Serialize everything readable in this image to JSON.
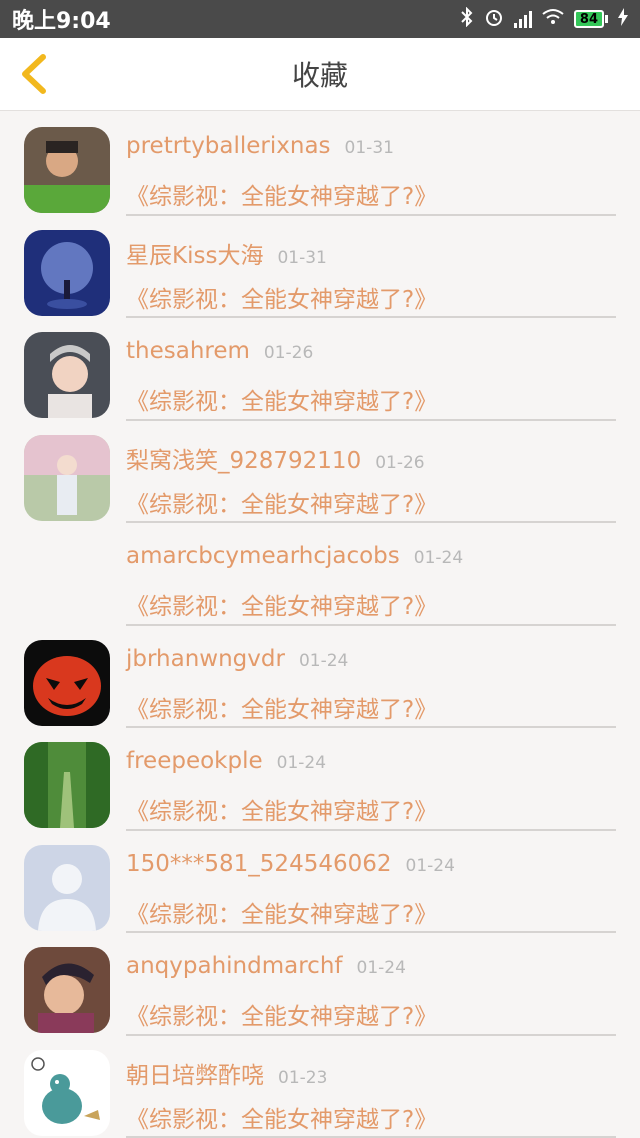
{
  "status": {
    "time": "晚上9:04",
    "battery": "84"
  },
  "header": {
    "title": "收藏"
  },
  "items": [
    {
      "name": "pretrtyballerixnas",
      "date": "01-31",
      "subtitle": "《综影视：全能女神穿越了?》"
    },
    {
      "name": "星辰Kiss大海",
      "date": "01-31",
      "subtitle": "《综影视：全能女神穿越了?》"
    },
    {
      "name": "thesahrem",
      "date": "01-26",
      "subtitle": "《综影视：全能女神穿越了?》"
    },
    {
      "name": "梨窝浅笑_928792110",
      "date": "01-26",
      "subtitle": "《综影视：全能女神穿越了?》"
    },
    {
      "name": "amarcbcymearhcjacobs",
      "date": "01-24",
      "subtitle": "《综影视：全能女神穿越了?》"
    },
    {
      "name": "jbrhanwngvdr",
      "date": "01-24",
      "subtitle": "《综影视：全能女神穿越了?》"
    },
    {
      "name": "freepeokple",
      "date": "01-24",
      "subtitle": "《综影视：全能女神穿越了?》"
    },
    {
      "name": "150***581_524546062",
      "date": "01-24",
      "subtitle": "《综影视：全能女神穿越了?》"
    },
    {
      "name": "anqypahindmarchf",
      "date": "01-24",
      "subtitle": "《综影视：全能女神穿越了?》"
    },
    {
      "name": "朝日培弊酢哓",
      "date": "01-23",
      "subtitle": "《综影视：全能女神穿越了?》"
    }
  ]
}
